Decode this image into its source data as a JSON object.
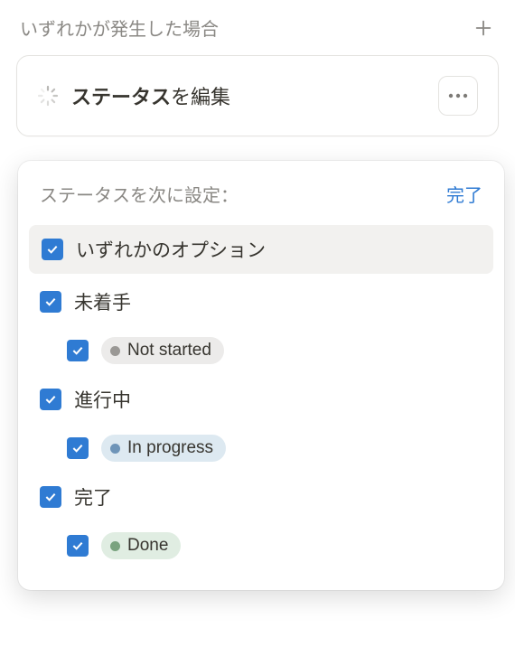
{
  "trigger": {
    "title": "いずれかが発生した場合"
  },
  "action": {
    "title_bold": "ステータス",
    "title_rest": "を編集"
  },
  "popup": {
    "header_label": "ステータスを次に設定：",
    "done_label": "完了",
    "any_option_label": "いずれかのオプション",
    "groups": [
      {
        "label": "未着手",
        "items": [
          {
            "text": "Not started",
            "pill": "default"
          }
        ]
      },
      {
        "label": "進行中",
        "items": [
          {
            "text": "In progress",
            "pill": "blue"
          }
        ]
      },
      {
        "label": "完了",
        "items": [
          {
            "text": "Done",
            "pill": "green"
          }
        ]
      }
    ]
  }
}
